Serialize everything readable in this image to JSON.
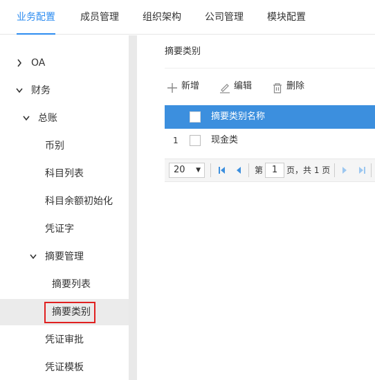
{
  "topnav": {
    "tabs": [
      {
        "label": "业务配置"
      },
      {
        "label": "成员管理"
      },
      {
        "label": "组织架构"
      },
      {
        "label": "公司管理"
      },
      {
        "label": "模块配置"
      }
    ],
    "active_color": "#2d8cf0"
  },
  "sidebar": {
    "items": [
      {
        "label": "OA",
        "expanded": false
      },
      {
        "label": "财务",
        "expanded": true
      },
      {
        "label": "总账",
        "expanded": true
      },
      {
        "label": "币别"
      },
      {
        "label": "科目列表"
      },
      {
        "label": "科目余额初始化"
      },
      {
        "label": "凭证字"
      },
      {
        "label": "摘要管理",
        "expanded": true
      },
      {
        "label": "摘要列表"
      },
      {
        "label": "摘要类别",
        "selected": true
      },
      {
        "label": "凭证审批"
      },
      {
        "label": "凭证模板"
      }
    ],
    "highlight_color": "#e02020"
  },
  "content": {
    "breadcrumb": "摘要类别",
    "toolbar": {
      "add_label": "新增",
      "edit_label": "编辑",
      "delete_label": "删除"
    },
    "grid": {
      "header_color": "#3c8fde",
      "columns": [
        "摘要类别名称"
      ],
      "rows": [
        {
          "num": "1",
          "name": "现金类"
        }
      ]
    },
    "pager": {
      "page_size": "20",
      "page_prefix": "第",
      "page_value": "1",
      "page_suffix": "页，共 1 页"
    }
  }
}
